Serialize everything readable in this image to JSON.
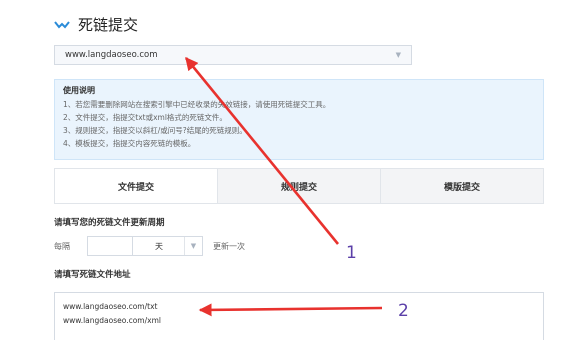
{
  "page": {
    "title": "死链提交",
    "site_value": "www.langdaoseo.com"
  },
  "usage": {
    "title": "使用说明",
    "lines": [
      "1、若您需要删除网站在搜索引擎中已经收录的失效链接，请使用死链提交工具。",
      "2、文件提交，指提交txt或xml格式的死链文件。",
      "3、规则提交，指提交以斜杠/或问号?结尾的死链规则。",
      "4、模板提交，指提交内容死链的模板。"
    ]
  },
  "tabs": [
    {
      "label": "文件提交",
      "active": true
    },
    {
      "label": "规则提交",
      "active": false
    },
    {
      "label": "模版提交",
      "active": false
    }
  ],
  "period": {
    "label": "请填写您的死链文件更新周期",
    "prefix": "每隔",
    "input_value": "",
    "unit": "天",
    "suffix": "更新一次"
  },
  "urls": {
    "label": "请填写死链文件地址",
    "lines": [
      "www.langdaoseo.com/txt",
      "www.langdaoseo.com/xml"
    ]
  },
  "annotations": {
    "marker_1": "1",
    "marker_2": "2",
    "arrow_color": "#e8322e"
  },
  "colors": {
    "accent": "#2a8bd8",
    "usage_bg": "#eaf4fd"
  }
}
